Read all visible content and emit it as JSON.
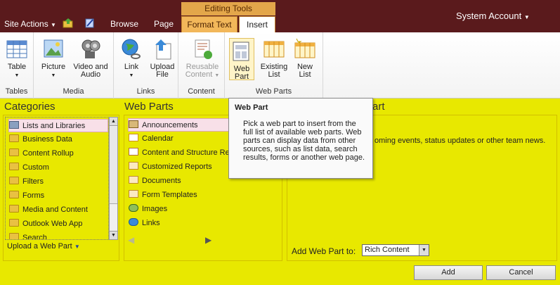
{
  "topbar": {
    "site_actions": "Site Actions",
    "browse": "Browse",
    "page": "Page",
    "context_group": "Editing Tools",
    "tab_format": "Format Text",
    "tab_insert": "Insert",
    "user": "System Account"
  },
  "ribbon": {
    "groups": {
      "tables": "Tables",
      "media": "Media",
      "links": "Links",
      "content": "Content",
      "webparts": "Web Parts"
    },
    "buttons": {
      "table": "Table",
      "picture": "Picture",
      "video_audio_1": "Video and",
      "video_audio_2": "Audio",
      "link": "Link",
      "upload_1": "Upload",
      "upload_2": "File",
      "reusable_1": "Reusable",
      "reusable_2": "Content",
      "webpart_1": "Web",
      "webpart_2": "Part",
      "existing_1": "Existing",
      "existing_2": "List",
      "newlist_1": "New",
      "newlist_2": "List"
    }
  },
  "categories": {
    "title": "Categories",
    "items": [
      "Lists and Libraries",
      "Business Data",
      "Content Rollup",
      "Custom",
      "Filters",
      "Forms",
      "Media and Content",
      "Outlook Web App",
      "Search"
    ],
    "upload_link": "Upload a Web Part"
  },
  "webparts": {
    "title": "Web Parts",
    "items": [
      "Announcements",
      "Calendar",
      "Content and Structure Re",
      "Customized Reports",
      "Documents",
      "Form Templates",
      "Images",
      "Links"
    ]
  },
  "about": {
    "title_suffix": "art",
    "desc": "oming events, status updates or other team news.",
    "add_to_label": "Add Web Part to:",
    "zone_value": "Rich Content"
  },
  "tooltip": {
    "title": "Web Part",
    "body": "Pick a web part to insert from the full list of available web parts. Web parts can display data from other sources, such as list data, search results, forms or another web page."
  },
  "actions": {
    "add": "Add",
    "cancel": "Cancel"
  },
  "colors": {
    "topbar": "#5a1a1c",
    "panel_bg": "#e8e800",
    "context_tab": "#f2b75a"
  }
}
